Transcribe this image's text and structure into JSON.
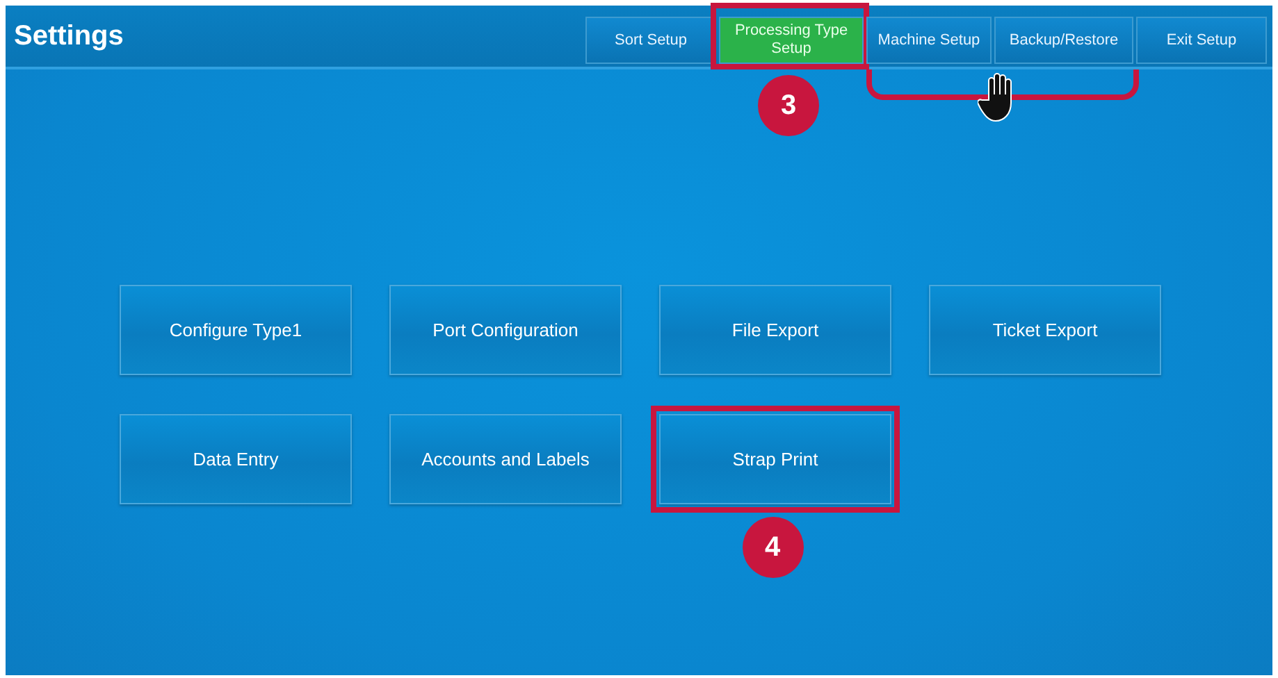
{
  "title": "Settings",
  "tabs": [
    {
      "label": "Sort Setup",
      "selected": false,
      "bracketed": false
    },
    {
      "label": "Processing Type Setup",
      "selected": true,
      "callout": "3",
      "bracketed": false
    },
    {
      "label": "Machine Setup",
      "selected": false,
      "bracketed": true
    },
    {
      "label": "Backup/Restore",
      "selected": false,
      "bracketed": true
    },
    {
      "label": "Exit Setup",
      "selected": false,
      "bracketed": false
    }
  ],
  "tiles": [
    {
      "label": "Configure Type1"
    },
    {
      "label": "Port Configuration"
    },
    {
      "label": "File Export"
    },
    {
      "label": "Ticket Export"
    },
    {
      "label": "Data Entry"
    },
    {
      "label": "Accounts and Labels"
    },
    {
      "label": "Strap Print",
      "callout": "4"
    }
  ]
}
